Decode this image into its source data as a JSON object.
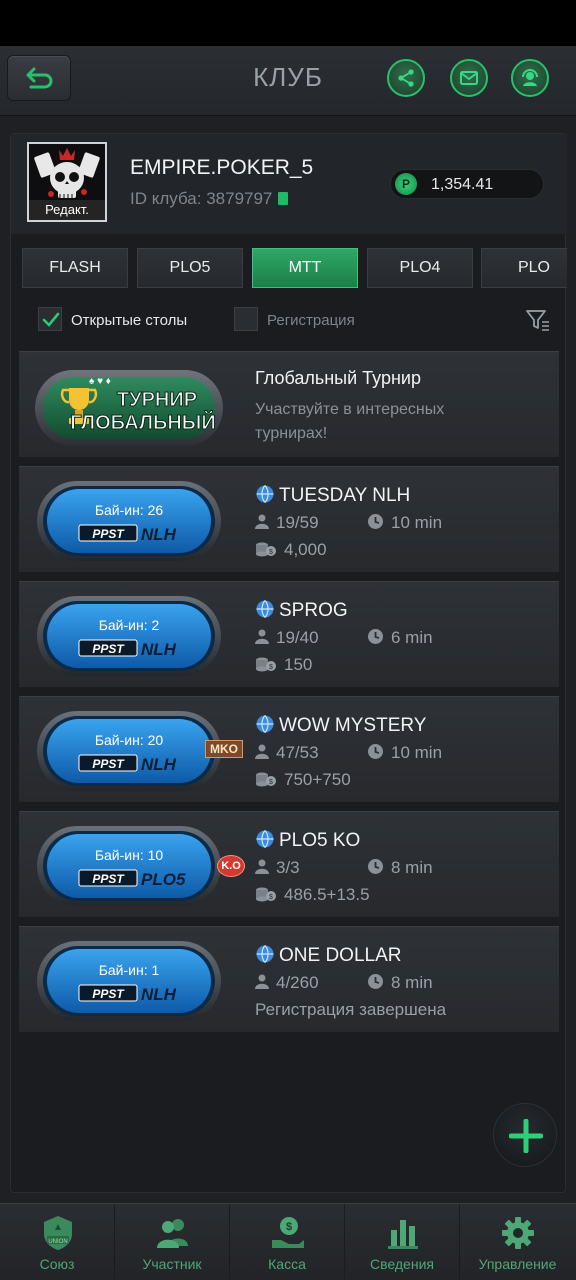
{
  "header": {
    "title": "КЛУБ"
  },
  "club": {
    "name": "EMPIRE.POKER_5",
    "id_text": "ID клуба: 3879797",
    "avatar_edit": "Редакт.",
    "balance_coin": "P",
    "balance": "1,354.41"
  },
  "tabs": [
    "FLASH",
    "PLO5",
    "MTT",
    "PLO4",
    "PLO"
  ],
  "active_tab": "MTT",
  "filters": {
    "open_tables": {
      "label": "Открытые столы",
      "checked": true
    },
    "registration": {
      "label": "Регистрация",
      "checked": false
    }
  },
  "global_tournament": {
    "badge_line1": "ТУРНИР",
    "badge_line2": "ГЛОБАЛЬНЫЙ",
    "title": "Глобальный Турнир",
    "description": "Участвуйте в интересных турнирах!"
  },
  "tournaments": [
    {
      "name": "TUESDAY NLH",
      "buyin": "Бай-ин: 26",
      "brand": "PPST",
      "game": "NLH",
      "players": "19/59",
      "time": "10 min",
      "third": "4,000",
      "third_type": "prize",
      "tag": ""
    },
    {
      "name": "SPROG",
      "buyin": "Бай-ин: 2",
      "brand": "PPST",
      "game": "NLH",
      "players": "19/40",
      "time": "6 min",
      "third": "150",
      "third_type": "prize",
      "tag": ""
    },
    {
      "name": "WOW MYSTERY",
      "buyin": "Бай-ин: 20",
      "brand": "PPST",
      "game": "NLH",
      "players": "47/53",
      "time": "10 min",
      "third": "750+750",
      "third_type": "prize",
      "tag": "MKO"
    },
    {
      "name": "PLO5 KO",
      "buyin": "Бай-ин: 10",
      "brand": "PPST",
      "game": "PLO5",
      "players": "3/3",
      "time": "8 min",
      "third": "486.5+13.5",
      "third_type": "prize",
      "tag": "K.O"
    },
    {
      "name": "ONE DOLLAR",
      "buyin": "Бай-ин: 1",
      "brand": "PPST",
      "game": "NLH",
      "players": "4/260",
      "time": "8 min",
      "third": "Регистрация завершена",
      "third_type": "status",
      "tag": ""
    }
  ],
  "bottom_nav": [
    {
      "label": "Союз",
      "icon": "union-icon",
      "badge": "UNION"
    },
    {
      "label": "Участник",
      "icon": "members-icon"
    },
    {
      "label": "Касса",
      "icon": "cashier-icon"
    },
    {
      "label": "Сведения",
      "icon": "stats-icon"
    },
    {
      "label": "Управление",
      "icon": "settings-icon"
    }
  ],
  "colors": {
    "accent": "#27c06b",
    "background": "#1e2023",
    "card": "#2e3136",
    "tab_active": "#2fa866"
  }
}
